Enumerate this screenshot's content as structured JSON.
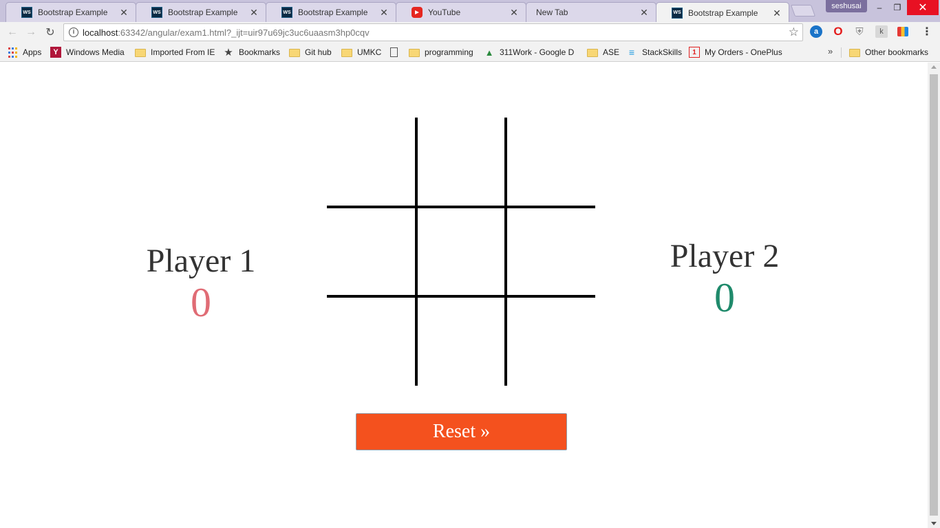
{
  "browser": {
    "tabs": [
      {
        "title": "Bootstrap Example",
        "icon": "webstorm-icon"
      },
      {
        "title": "Bootstrap Example",
        "icon": "webstorm-icon"
      },
      {
        "title": "Bootstrap Example",
        "icon": "webstorm-icon"
      },
      {
        "title": "YouTube",
        "icon": "youtube-icon"
      },
      {
        "title": "New Tab",
        "icon": ""
      },
      {
        "title": "Bootstrap Example",
        "icon": "webstorm-icon",
        "active": true
      }
    ],
    "profile_name": "seshusai",
    "ws_badge": "WS",
    "window_controls": {
      "minimize": "–",
      "restore": "❐",
      "close": "✕"
    },
    "tab_close_glyph": "✕",
    "url_host": "localhost",
    "url_rest": ":63342/angular/exam1.html?_ijt=uir97u69jc3uc6uaasm3hp0cqv",
    "bookmarks": [
      {
        "label": "Apps",
        "icon": "apps-grid-icon"
      },
      {
        "label": "Windows Media",
        "icon": "yahoo-icon"
      },
      {
        "label": "Imported From IE",
        "icon": "folder-icon"
      },
      {
        "label": "Bookmarks",
        "icon": "star-icon"
      },
      {
        "label": "Git hub",
        "icon": "folder-icon"
      },
      {
        "label": "UMKC",
        "icon": "folder-icon"
      },
      {
        "label": "",
        "icon": "page-icon"
      },
      {
        "label": "programming",
        "icon": "folder-icon"
      },
      {
        "label": "311Work - Google D",
        "icon": "google-drive-icon"
      },
      {
        "label": "ASE",
        "icon": "folder-icon"
      },
      {
        "label": "StackSkills",
        "icon": "stackskills-icon"
      },
      {
        "label": "My Orders - OnePlus",
        "icon": "oneplus-icon"
      }
    ],
    "bookmarks_overflow": "»",
    "other_bookmarks": "Other bookmarks"
  },
  "game": {
    "player1": {
      "name": "Player 1",
      "score": "0",
      "color": "#e06c75"
    },
    "player2": {
      "name": "Player 2",
      "score": "0",
      "color": "#1f8a6b"
    },
    "board": [
      "",
      "",
      "",
      "",
      "",
      "",
      "",
      "",
      ""
    ],
    "reset_label": "Reset »",
    "reset_color": "#f4511e"
  }
}
